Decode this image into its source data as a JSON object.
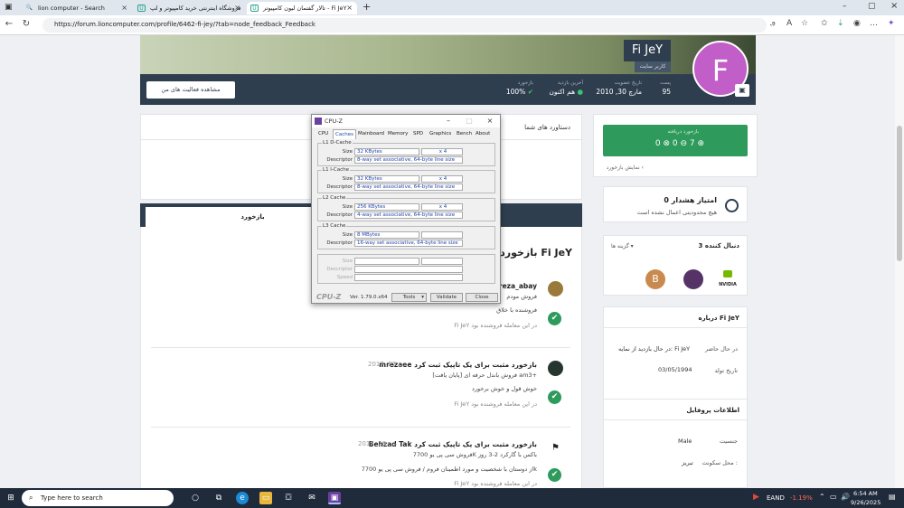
{
  "browser": {
    "tabs": [
      {
        "label": "lion computer - Search",
        "icon": "search-icon"
      },
      {
        "label": "فروشگاه اینترنتی خرید کامپیوتر و لپ",
        "icon": "lion-icon"
      },
      {
        "label": "تالار گفتمان لیون کامپیوتر - Fi JeY",
        "icon": "lion-icon"
      }
    ],
    "url": "https://forum.lioncomputer.com/profile/6462-fi-jey/?tab=node_feedback_Feedback"
  },
  "profile": {
    "avatar_letter": "F",
    "name": "Fi JeY",
    "title": "کاربر سایت",
    "stats": [
      {
        "key": "پست",
        "value": "95"
      },
      {
        "key": "تاریخ عضویت",
        "value": "مارچ 30, 2010"
      },
      {
        "key": "آخرین بازدید",
        "value": "هم اکنون"
      },
      {
        "key": "بازخورد",
        "value": "100%"
      }
    ],
    "activity_button": "مشاهده فعالیت های من"
  },
  "sidebar": {
    "feedback_title": "بازخورد دریافته",
    "feedback_counts": "0 ⊗ 0 ⊖ 7 ⊕",
    "feedback_link": "نمایش بازخورد ‹",
    "warning_points": "0 امتیاز هشدار",
    "warning_text": "هیچ محدودیتی اعمال نشده است",
    "followers_title": "3 دنبال کننده",
    "followers_option": "گزینه ها ▾",
    "followers": [
      {
        "label": "B",
        "color": "#c98a50"
      },
      {
        "label": "",
        "color": "#553366"
      },
      {
        "label": "NVIDIA",
        "color": "#ffffff"
      }
    ],
    "about_title": "درباره Fi JeY",
    "about_rows": [
      {
        "key": "در حال حاضر",
        "value": "در حال بازدید از نمایه: Fi JeY"
      },
      {
        "key": "تاریخ تولد",
        "value": "03/05/1994"
      }
    ],
    "info_title": "اطلاعات پروفایل",
    "info_rows": [
      {
        "key": "جنسیت",
        "value": "Male"
      },
      {
        "key": "محل سکونت :",
        "value": "تبریز"
      }
    ]
  },
  "main": {
    "achievements": "دستاورد های شما",
    "tab_label": "بازخورد",
    "heading": "بازخورد Fi JeY",
    "items": [
      {
        "name": "reza_abay",
        "date": "",
        "body": "فروش مودم",
        "note": "فروشنده با خلاق",
        "status": "Fi JeY در این معامله فروشنده بود"
      },
      {
        "name": "mrezaee بازخورد مثبت برای یک تاپیک ثبت کرد",
        "date": "می 22, 2017",
        "body": "[پایان یافت] فروش باندل حرفه ای am3+",
        "note": "خوش قول و خوش برخورد",
        "status": "Fi JeY در این معامله فروشنده بود"
      },
      {
        "name": "Behzad Tak بازخورد مثبت برای یک تاپیک ثبت کرد",
        "date": "می 20, 2017",
        "body": "فروش سی پی یو 7700K باکس با گارکرد 2-3 روز",
        "note": "از دوستان با شخصیت و مورد اطمینان فروم / فروش سی پی یو 7700k",
        "status": "Fi JeY در این معامله فروشنده بود"
      }
    ]
  },
  "cpuz": {
    "title": "CPU-Z",
    "tabs": [
      "CPU",
      "Caches",
      "Mainboard",
      "Memory",
      "SPD",
      "Graphics",
      "Bench",
      "About"
    ],
    "groups": [
      {
        "title": "L1 D-Cache",
        "size": "32 KBytes",
        "mult": "x 4",
        "desc": "8-way set associative, 64-byte line size"
      },
      {
        "title": "L1 I-Cache",
        "size": "32 KBytes",
        "mult": "x 4",
        "desc": "8-way set associative, 64-byte line size"
      },
      {
        "title": "L2 Cache",
        "size": "256 KBytes",
        "mult": "x 4",
        "desc": "4-way set associative, 64-byte line size"
      },
      {
        "title": "L3 Cache",
        "size": "8 MBytes",
        "mult": "",
        "desc": "16-way set associative, 64-byte line size"
      }
    ],
    "labels": {
      "size": "Size",
      "descriptor": "Descriptor",
      "speed": "Speed"
    },
    "brand": "CPU-Z",
    "version": "Ver. 1.79.0.x64",
    "tools": "Tools",
    "validate": "Validate",
    "close": "Close"
  },
  "taskbar": {
    "search_placeholder": "Type here to search",
    "ticker": "EAND",
    "ticker_change": "-1.19%",
    "time": "6:54 AM",
    "date": "9/26/2025"
  }
}
